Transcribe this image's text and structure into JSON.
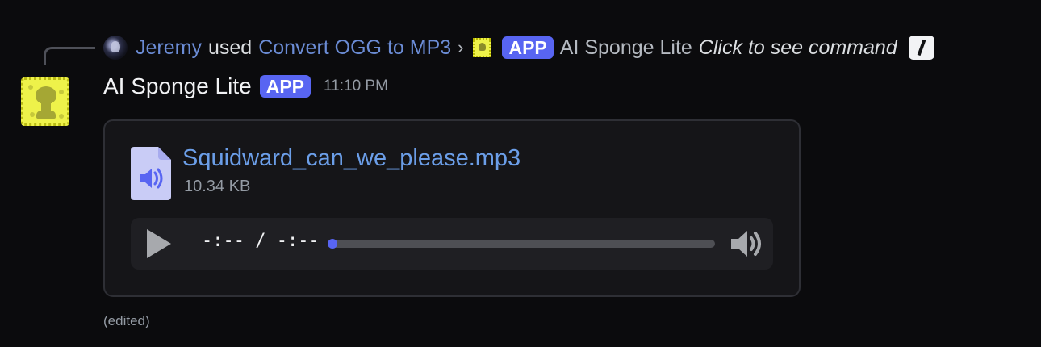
{
  "command_header": {
    "user_name": "Jeremy",
    "used_text": "used",
    "command_name": "Convert OGG to MP3",
    "chevron": "›",
    "badge": "APP",
    "bot_name": "AI Sponge Lite",
    "click_hint": "Click to see command"
  },
  "message": {
    "author": "AI Sponge Lite",
    "badge": "APP",
    "timestamp": "11:10 PM",
    "edited_label": "(edited)"
  },
  "attachment": {
    "file_name": "Squidward_can_we_please.mp3",
    "file_size": "10.34 KB",
    "icon": "audio-file-icon",
    "player": {
      "time_display": "-:-- / -:--",
      "progress": 0,
      "play_icon": "play-icon",
      "volume_icon": "volume-icon"
    }
  },
  "colors": {
    "background": "#0b0b0d",
    "accent": "#5865f2",
    "link": "#6b8cd5",
    "file_link": "#6b9ee8",
    "muted": "#949ba4"
  }
}
